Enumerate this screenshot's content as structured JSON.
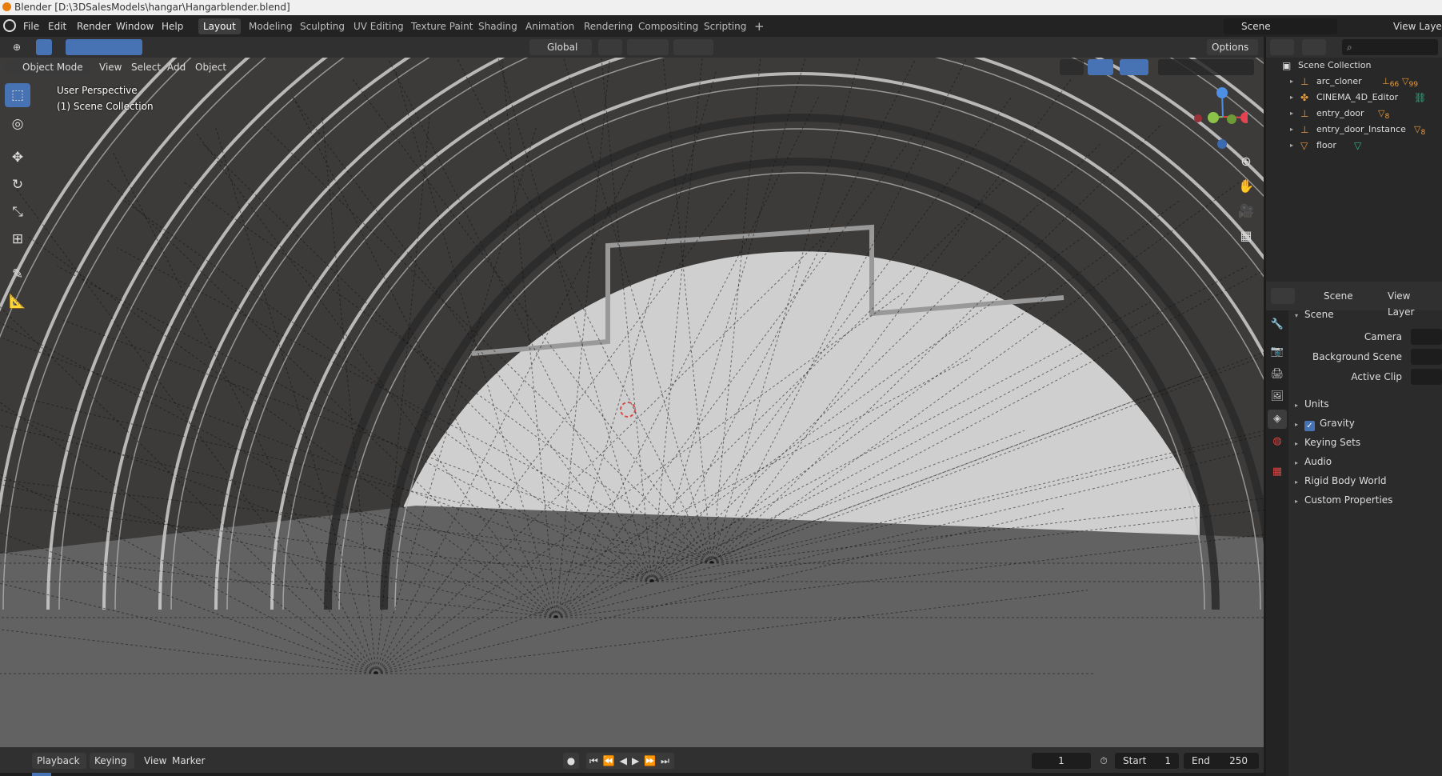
{
  "window": {
    "title": "Blender [D:\\3DSalesModels\\hangar\\Hangarblender.blend]"
  },
  "menu": [
    "File",
    "Edit",
    "Render",
    "Window",
    "Help"
  ],
  "workspaces": [
    "Layout",
    "Modeling",
    "Sculpting",
    "UV Editing",
    "Texture Paint",
    "Shading",
    "Animation",
    "Rendering",
    "Compositing",
    "Scripting"
  ],
  "active_workspace": "Layout",
  "add_workspace": "+",
  "scene_selector": {
    "scene": "Scene",
    "view_layer": "View Laye"
  },
  "viewport_header": {
    "transform_orientation": "Global",
    "options": "Options",
    "mode": "Object Mode",
    "menus": [
      "View",
      "Select",
      "Add",
      "Object"
    ]
  },
  "viewport": {
    "perspective_label": "User Perspective",
    "collection_label": "(1) Scene Collection"
  },
  "gizmo_colors": {
    "x": "#e5434f",
    "y": "#8bc34a",
    "z": "#4d8fe3"
  },
  "outliner": {
    "root": "Scene Collection",
    "items": [
      {
        "name": "arc_cloner",
        "badge1": "66",
        "badge2": "99"
      },
      {
        "name": "CINEMA_4D_Editor",
        "badge1": "",
        "badge2": ""
      },
      {
        "name": "entry_door",
        "badge1": "8",
        "badge2": ""
      },
      {
        "name": "entry_door_Instance",
        "badge1": "8",
        "badge2": ""
      },
      {
        "name": "floor",
        "badge1": "",
        "badge2": ""
      }
    ]
  },
  "properties": {
    "tab_scene": "Scene",
    "tab_view_layer": "View Layer",
    "panel_title": "Scene",
    "fields": [
      {
        "label": "Camera"
      },
      {
        "label": "Background Scene"
      },
      {
        "label": "Active Clip"
      }
    ],
    "sections": [
      "Units",
      "Gravity",
      "Keying Sets",
      "Audio",
      "Rigid Body World",
      "Custom Properties"
    ],
    "gravity_checked": true
  },
  "timeline": {
    "menus": [
      "Playback",
      "Keying",
      "View",
      "Marker"
    ],
    "current_frame": "1",
    "start_label": "Start",
    "start": "1",
    "end_label": "End",
    "end": "250"
  },
  "accent_color": "#4772b3"
}
